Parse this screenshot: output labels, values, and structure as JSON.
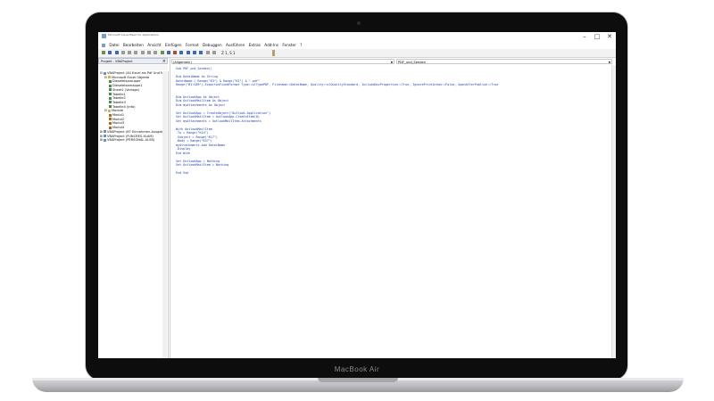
{
  "device": {
    "brand": "MacBook Air"
  },
  "window": {
    "title": "Microsoft Visual Basic for Applications",
    "controls": {
      "minimize": "–",
      "maximize": "□",
      "close": "✕"
    }
  },
  "menubar": {
    "items": [
      "Datei",
      "Bearbeiten",
      "Ansicht",
      "Einfügen",
      "Format",
      "Debuggen",
      "Ausführen",
      "Extras",
      "Add-Ins",
      "Fenster",
      "?"
    ]
  },
  "toolbar": {
    "position_text": "Z 1, S 1"
  },
  "project_pane": {
    "title": "Projekt - VBAProject",
    "close": "×",
    "tree": [
      {
        "label": "VBAProject (44 Excel als Pdf Und Ma",
        "level": 0,
        "icon": "project-icon",
        "expand": "⊟"
      },
      {
        "label": "Microsoft Excel Objekte",
        "level": 1,
        "icon": "folder-icon",
        "expand": "⊟"
      },
      {
        "label": "Dieseletsarouppe",
        "level": 2,
        "icon": "sheet-icon",
        "expand": ""
      },
      {
        "label": "Dieseletsamappe1",
        "level": 2,
        "icon": "sheet-icon",
        "expand": ""
      },
      {
        "label": "Sheet1 (Vorlage)",
        "level": 2,
        "icon": "sheet-icon",
        "expand": ""
      },
      {
        "label": "Tabelle1",
        "level": 2,
        "icon": "sheet-icon",
        "expand": ""
      },
      {
        "label": "Tabelle2",
        "level": 2,
        "icon": "sheet-icon",
        "expand": ""
      },
      {
        "label": "Tabelle3",
        "level": 2,
        "icon": "sheet-icon",
        "expand": ""
      },
      {
        "label": "Tabelle4 (Info)",
        "level": 2,
        "icon": "sheet-icon",
        "expand": ""
      },
      {
        "label": "Module",
        "level": 1,
        "icon": "folder-icon",
        "expand": "⊟"
      },
      {
        "label": "Modul1",
        "level": 2,
        "icon": "module-icon",
        "expand": ""
      },
      {
        "label": "Modul2",
        "level": 2,
        "icon": "module-icon",
        "expand": ""
      },
      {
        "label": "Modul3",
        "level": 2,
        "icon": "module-icon",
        "expand": ""
      },
      {
        "label": "Modul4",
        "level": 2,
        "icon": "module-icon",
        "expand": ""
      },
      {
        "label": "VBAProject (67 Einnahmen-Ausgabe",
        "level": 0,
        "icon": "project-icon",
        "expand": "⊞"
      },
      {
        "label": "VBAProject (FUNCRES.XLAM)",
        "level": 0,
        "icon": "project-icon",
        "expand": "⊞"
      },
      {
        "label": "VBAProject (PERSONAL.XLSB)",
        "level": 0,
        "icon": "project-icon",
        "expand": "⊞"
      }
    ]
  },
  "code_pane": {
    "object_combo": "(Allgemein)",
    "procedure_combo": "PDF_und_Senden",
    "lines": [
      "Sub PDF_und_Senden()",
      "",
      "Dim DateiName As String",
      "DateiName = Range(\"K3\") & Range(\"K2\") & \".pdf\"",
      "Range(\"B1:G89\").ExportAsFixedFormat Type:=xlTypePDF, Filename:=DateiName, Quality:=xlQualityStandard, IncludeDocProperties:=True, IgnorePrintAreas:=False, OpenAfterPublish:=True",
      "",
      "",
      "Dim OutlookApp As Object",
      "Dim OutlookMailItem As Object",
      "Dim myAttachments As Object",
      "",
      "Set OutlookApp = CreateObject(\"Outlook.Application\")",
      "Set OutlookMailItem = OutlookApp.CreateItem(0)",
      "Set myAttachments = OutlookMailItem.Attachments",
      "",
      "With OutlookMailItem",
      ".To = Range(\"K14\")",
      ".Subject = Range(\"K17\")",
      ".Body = Range(\"K37\")",
      "myAttachments.Add DateiName",
      ".Display",
      "End With",
      "",
      "Set OutlookApp = Nothing",
      "Set OutlookMailItem = Nothing",
      "",
      "End Sub"
    ]
  }
}
